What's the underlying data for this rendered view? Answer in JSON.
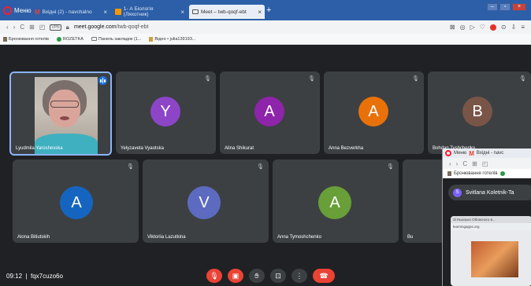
{
  "browser": {
    "menu_label": "Меню",
    "tabs": [
      {
        "label": "Вхідні (2) - navchalno",
        "icon": "gmail-icon"
      },
      {
        "label": "1- А Біологія (Ляхотник)",
        "icon": "classroom-icon"
      },
      {
        "label": "Meet – twb-qoqf-ebt",
        "icon": "meet-icon",
        "active": true
      }
    ],
    "url_prefix": "meet.google.com",
    "url_path": "/twb-qoqf-ebt",
    "vpn_label": "VPN",
    "bookmarks": [
      {
        "label": "Бронювання готелів",
        "icon": "file-icon"
      },
      {
        "label": "ROZETKA",
        "icon": "rozetka-icon"
      },
      {
        "label": "Панель закладок (1...",
        "icon": "folder-icon"
      },
      {
        "label": "Відео • julia139193...",
        "icon": "video-icon"
      }
    ]
  },
  "meet": {
    "participants": [
      {
        "name": "Lyudmila Yaroshevska",
        "avatar_letter": "",
        "color": "",
        "video": true
      },
      {
        "name": "Yelyzaveta Vyaotska",
        "avatar_letter": "Y",
        "color": "#8d45c7"
      },
      {
        "name": "Alina Shikurat",
        "avatar_letter": "A",
        "color": "#8e24aa"
      },
      {
        "name": "Anna Bezverkha",
        "avatar_letter": "A",
        "color": "#e8710a"
      },
      {
        "name": "Bohdan Tyshchenko",
        "avatar_letter": "B",
        "color": "#795548"
      },
      {
        "name": "Alona Bitiutskih",
        "avatar_letter": "A",
        "color": "#1565c0"
      },
      {
        "name": "Viktoriia Lazutkina",
        "avatar_letter": "V",
        "color": "#5c6bc0"
      },
      {
        "name": "Anna Tymoshchenko",
        "avatar_letter": "A",
        "color": "#689f38"
      },
      {
        "name": "Bu",
        "avatar_letter": "",
        "color": ""
      }
    ],
    "time": "09:12",
    "meeting_code": "fqx7cuzo6o"
  },
  "popup": {
    "menu_label": "Меню",
    "tab_label": "Вхідні - navc",
    "bookmark_label": "Бронювання готелів",
    "presenter_initial": "S",
    "presenter": "Svitlana Koletnik-Ta",
    "share_tab_label": "Зі Ньюзько Обласного в...",
    "share_url": "learningapps.org"
  }
}
